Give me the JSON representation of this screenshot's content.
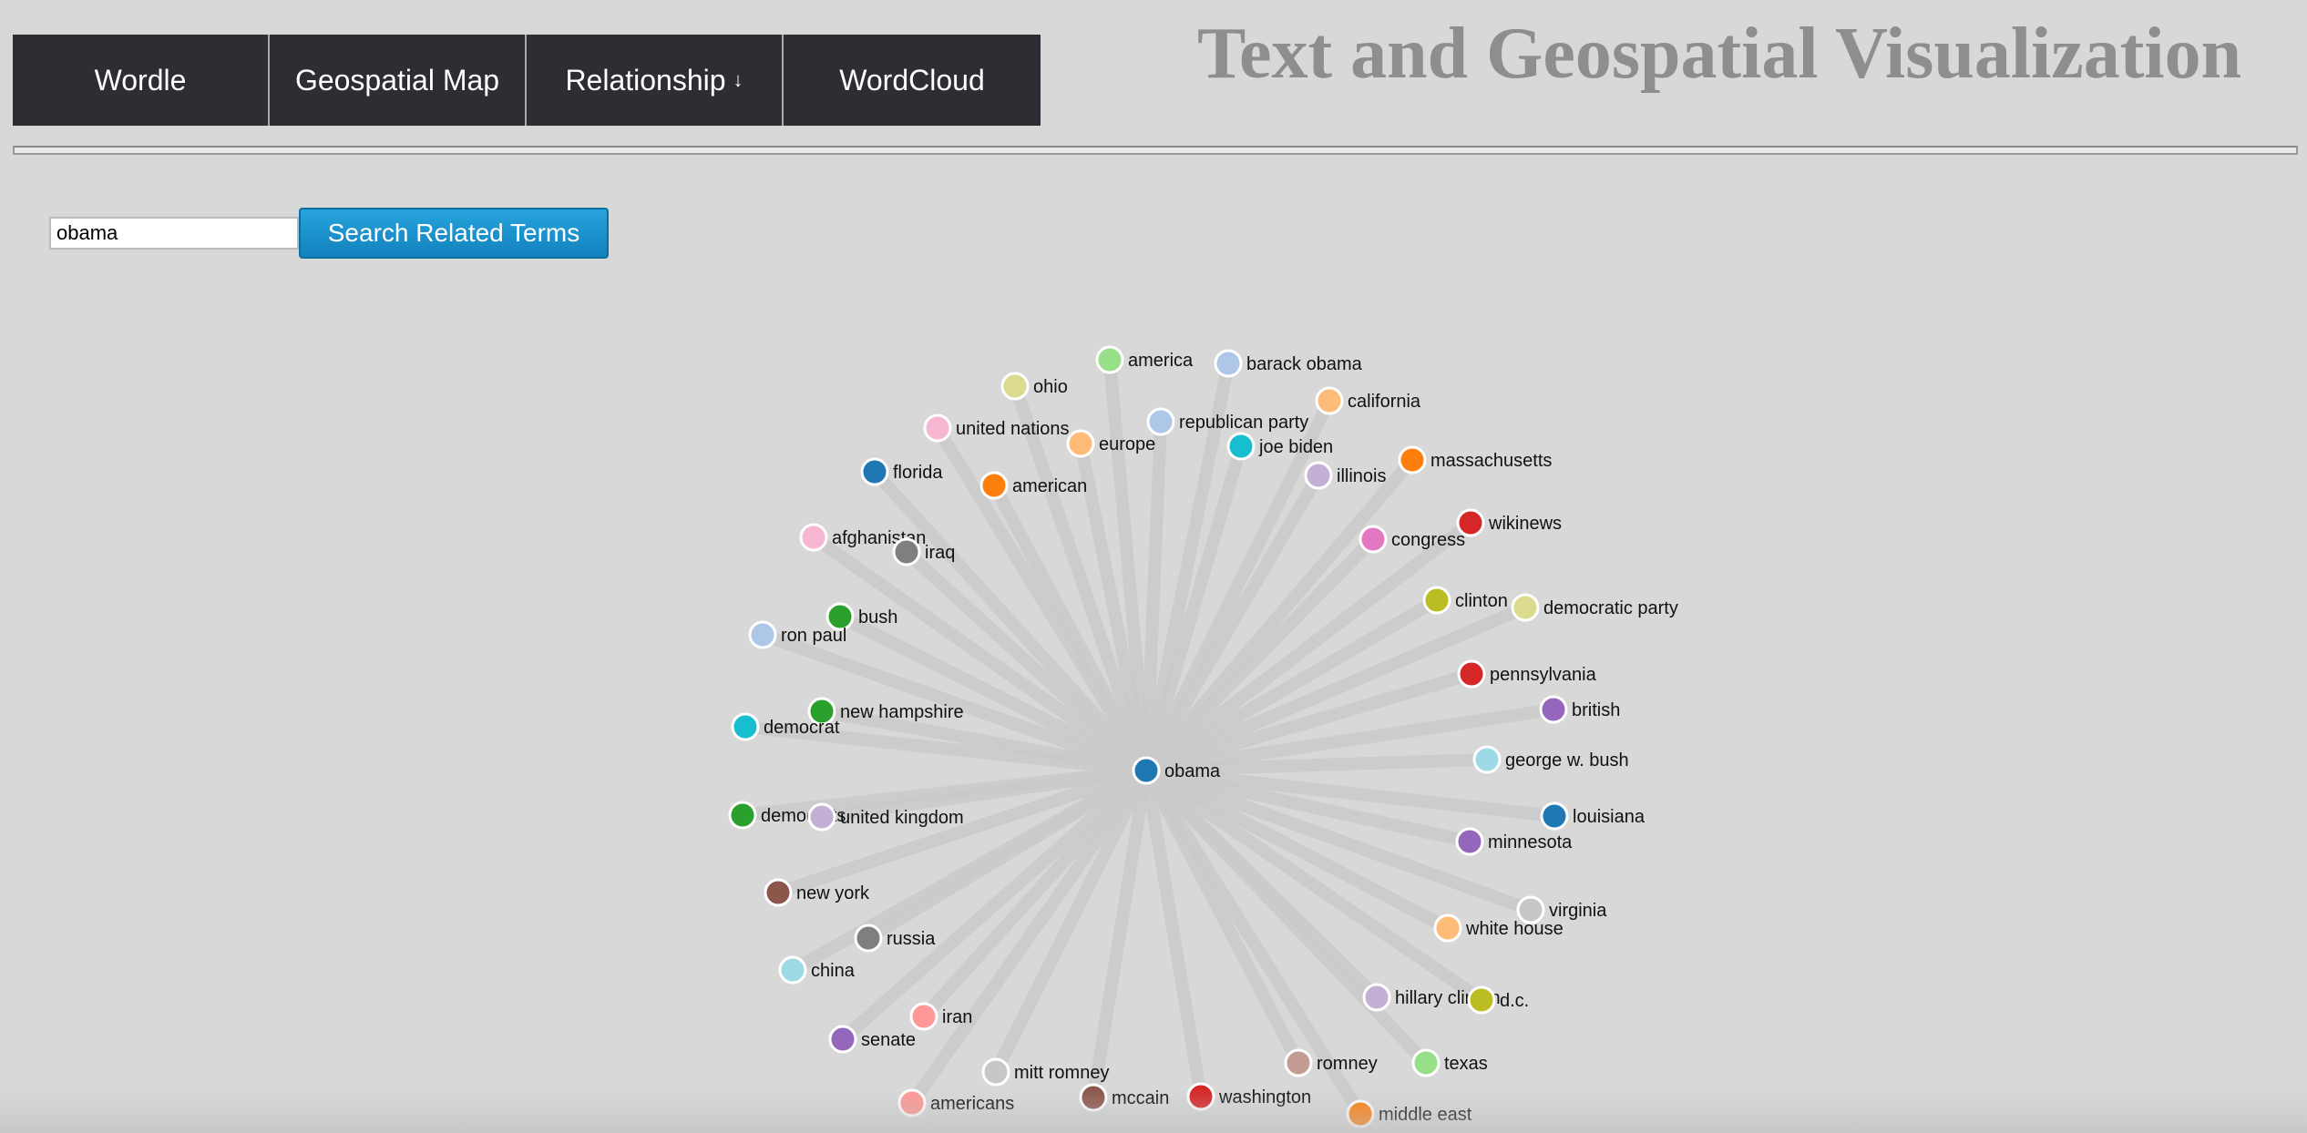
{
  "page_title": "Text and Geospatial Visualization",
  "nav": {
    "items": [
      {
        "id": "wordle",
        "label": "Wordle",
        "arrow": ""
      },
      {
        "id": "geospatial-map",
        "label": "Geospatial Map",
        "arrow": ""
      },
      {
        "id": "relationship",
        "label": "Relationship",
        "arrow": "↓"
      },
      {
        "id": "wordcloud",
        "label": "WordCloud",
        "arrow": ""
      }
    ]
  },
  "search": {
    "value": "obama",
    "button_label": "Search Related Terms"
  },
  "graph": {
    "center": {
      "label": "obama",
      "color": "#1f77b4"
    },
    "link_color": "#c9c9c9",
    "nodes": [
      {
        "label": "america",
        "color": "#98df8a"
      },
      {
        "label": "barack obama",
        "color": "#aec7e8"
      },
      {
        "label": "ohio",
        "color": "#dbdb8d"
      },
      {
        "label": "california",
        "color": "#ffbb78"
      },
      {
        "label": "united nations",
        "color": "#f7b6d2"
      },
      {
        "label": "republican party",
        "color": "#aec7e8"
      },
      {
        "label": "europe",
        "color": "#ffbb78"
      },
      {
        "label": "joe biden",
        "color": "#17becf"
      },
      {
        "label": "massachusetts",
        "color": "#ff7f0e"
      },
      {
        "label": "florida",
        "color": "#1f77b4"
      },
      {
        "label": "illinois",
        "color": "#c5b0d5"
      },
      {
        "label": "american",
        "color": "#ff7f0e"
      },
      {
        "label": "wikinews",
        "color": "#d62728"
      },
      {
        "label": "afghanistan",
        "color": "#f7b6d2"
      },
      {
        "label": "congress",
        "color": "#e377c2"
      },
      {
        "label": "iraq",
        "color": "#7f7f7f"
      },
      {
        "label": "clinton",
        "color": "#bcbd22"
      },
      {
        "label": "democratic party",
        "color": "#dbdb8d"
      },
      {
        "label": "bush",
        "color": "#2ca02c"
      },
      {
        "label": "ron paul",
        "color": "#aec7e8"
      },
      {
        "label": "pennsylvania",
        "color": "#d62728"
      },
      {
        "label": "new hampshire",
        "color": "#2ca02c"
      },
      {
        "label": "british",
        "color": "#9467bd"
      },
      {
        "label": "democrat",
        "color": "#17becf"
      },
      {
        "label": "george w. bush",
        "color": "#9edae5"
      },
      {
        "label": "democrats",
        "color": "#2ca02c"
      },
      {
        "label": "united kingdom",
        "color": "#c5b0d5"
      },
      {
        "label": "louisiana",
        "color": "#1f77b4"
      },
      {
        "label": "minnesota",
        "color": "#9467bd"
      },
      {
        "label": "new york",
        "color": "#8c564b"
      },
      {
        "label": "virginia",
        "color": "#c7c7c7"
      },
      {
        "label": "russia",
        "color": "#7f7f7f"
      },
      {
        "label": "white house",
        "color": "#ffbb78"
      },
      {
        "label": "china",
        "color": "#9edae5"
      },
      {
        "label": "hillary clinton",
        "color": "#c5b0d5"
      },
      {
        "label": "d.c.",
        "color": "#bcbd22"
      },
      {
        "label": "iran",
        "color": "#ff9896"
      },
      {
        "label": "senate",
        "color": "#9467bd"
      },
      {
        "label": "romney",
        "color": "#c49c94"
      },
      {
        "label": "texas",
        "color": "#98df8a"
      },
      {
        "label": "mitt romney",
        "color": "#c7c7c7"
      },
      {
        "label": "mccain",
        "color": "#8c564b"
      },
      {
        "label": "washington",
        "color": "#d62728"
      },
      {
        "label": "americans",
        "color": "#ff9896"
      },
      {
        "label": "middle east",
        "color": "#ff7f0e"
      }
    ]
  }
}
